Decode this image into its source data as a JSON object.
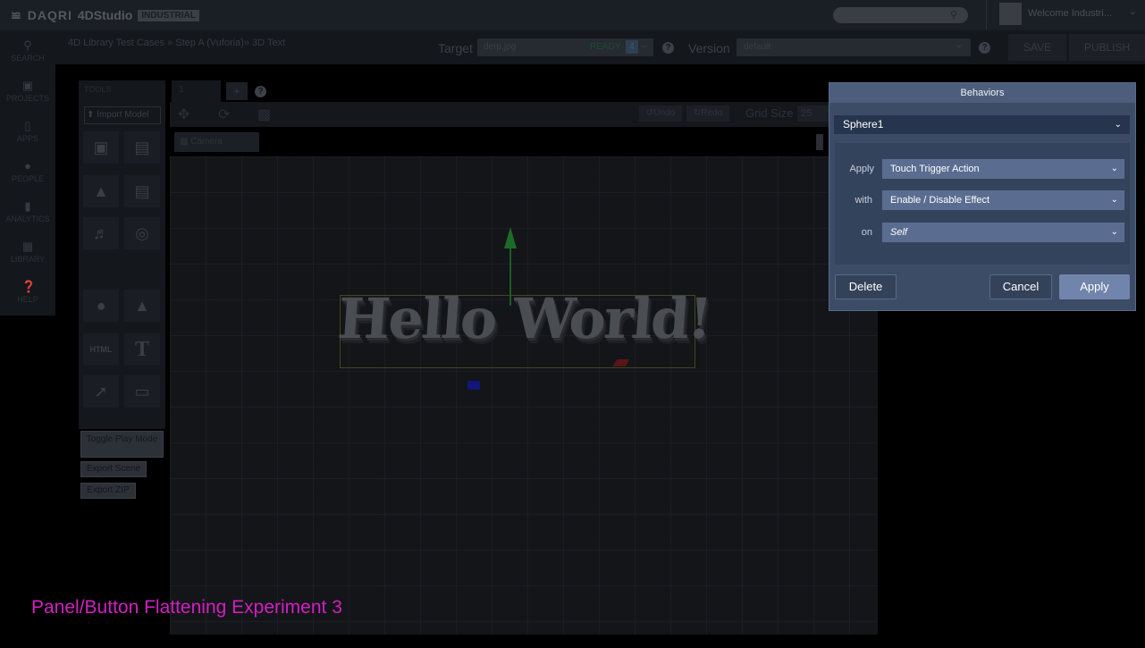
{
  "app": {
    "brand": "DAQRI",
    "product": "4DStudio",
    "edition": "INDUSTRIAL",
    "welcome": "Welcome Industri..."
  },
  "breadcrumb": "4D Library Test Cases  » Step A (Vuforia)» 3D Text",
  "header": {
    "target_label": "Target",
    "target_value": "derp.jpg",
    "target_status": "READY",
    "target_count": "4",
    "version_label": "Version",
    "version_value": "default",
    "save": "SAVE",
    "publish": "PUBLISH",
    "help": "?"
  },
  "nav": {
    "items": [
      {
        "label": "SEARCH",
        "icon": "search-icon"
      },
      {
        "label": "PROJECTS",
        "icon": "briefcase-icon"
      },
      {
        "label": "APPS",
        "icon": "phone-icon"
      },
      {
        "label": "PEOPLE",
        "icon": "person-icon"
      },
      {
        "label": "ANALYTICS",
        "icon": "bar-chart-icon"
      },
      {
        "label": "LIBRARY",
        "icon": "library-icon"
      },
      {
        "label": "HELP",
        "icon": "help-icon"
      }
    ]
  },
  "tools": {
    "title": "TOOLS",
    "import_model": "Import Model",
    "html_label": "HTML",
    "text_label": "T",
    "toggle_play_mode": "Toggle Play Mode",
    "export_scene": "Export Scene",
    "export_zip": "Export ZIP"
  },
  "editor": {
    "tab_label": "1",
    "add_tab": "+",
    "undo": "Undo",
    "redo": "Redo",
    "grid_size_label": "Grid Size",
    "grid_size_value": "25",
    "camera": "Camera",
    "scene_text": "Hello World!"
  },
  "experiment_label": "Panel/Button Flattening Experiment 3",
  "behaviors": {
    "title": "Behaviors",
    "object": "Sphere1",
    "apply_label": "Apply",
    "apply_value": "Touch Trigger Action",
    "with_label": "with",
    "with_value": "Enable / Disable Effect",
    "on_label": "on",
    "on_value": "Self",
    "delete": "Delete",
    "cancel": "Cancel",
    "apply_button": "Apply"
  },
  "colors": {
    "experiment_text": "#d21fc2",
    "dialog_bg": "#3d4c66",
    "dialog_select": "#5a6d90",
    "apply_button": "#7184ac"
  }
}
